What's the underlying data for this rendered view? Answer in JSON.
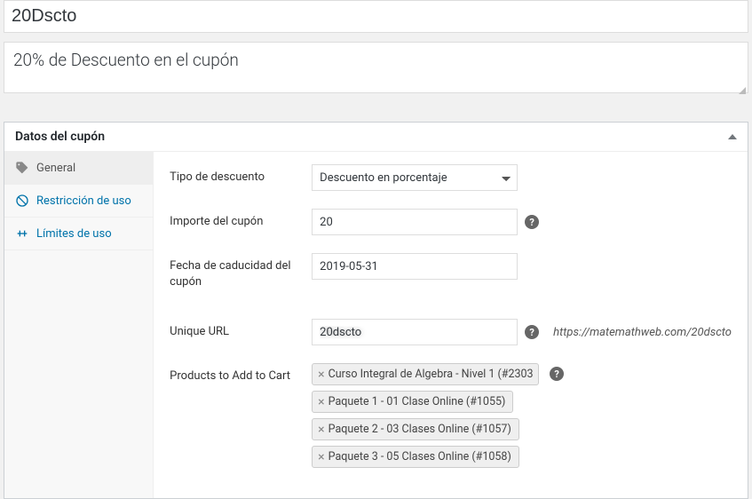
{
  "title": "20Dscto",
  "description": "20% de Descuento en el cupón",
  "panel_title": "Datos del cupón",
  "nav": {
    "general": "General",
    "restriction": "Restricción de uso",
    "limits": "Límites de uso"
  },
  "form": {
    "discount_type_label": "Tipo de descuento",
    "discount_type_value": "Descuento en porcentaje",
    "amount_label": "Importe del cupón",
    "amount_value": "20",
    "expiry_label": "Fecha de caducidad del cupón",
    "expiry_value": "2019-05-31",
    "unique_url_label": "Unique URL",
    "unique_url_value": "20dscto",
    "unique_url_hint": "https://matemathweb.com/20dscto",
    "products_label": "Products to Add to Cart",
    "products": [
      "Curso Integral de Algebra - Nivel 1 (#2303",
      "Paquete 1 - 01 Clase Online (#1055)",
      "Paquete 2 - 03 Clases Online (#1057)",
      "Paquete 3 - 05 Clases Online (#1058)"
    ]
  }
}
